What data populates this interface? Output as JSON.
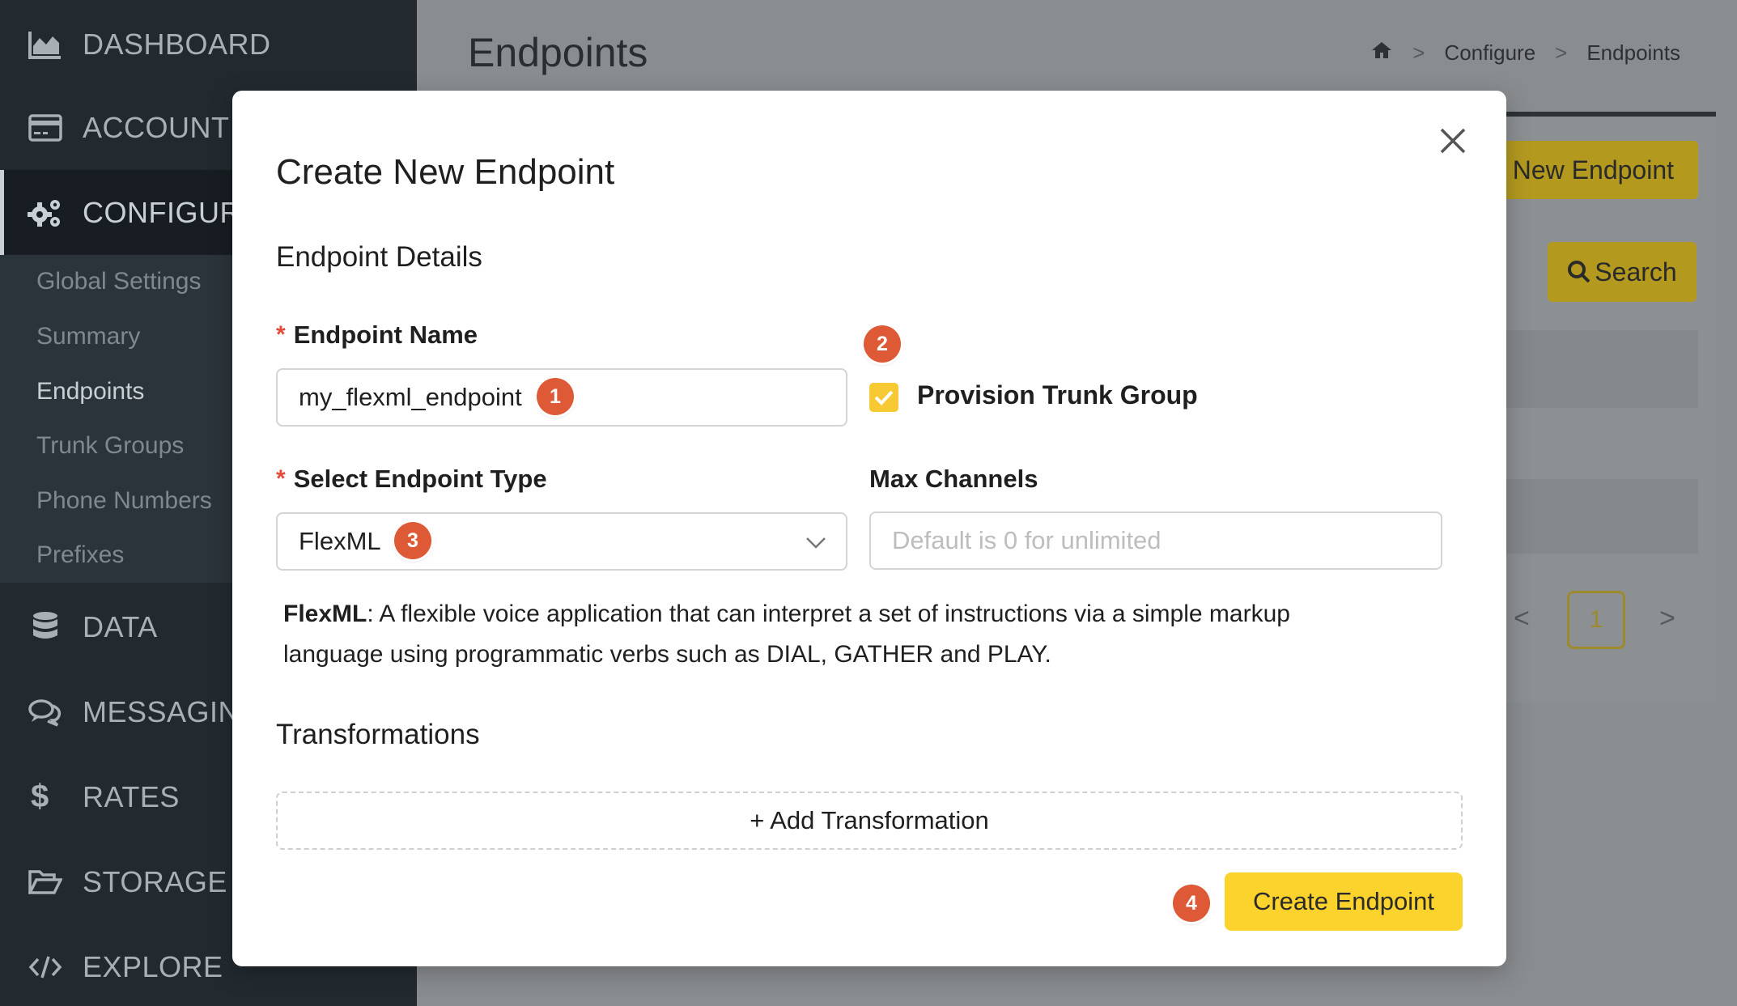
{
  "sidebar": {
    "items": [
      {
        "label": "DASHBOARD",
        "icon": "area-chart-icon"
      },
      {
        "label": "ACCOUNT",
        "icon": "credit-card-icon"
      },
      {
        "label": "CONFIGURE",
        "icon": "gears-icon"
      },
      {
        "label": "DATA",
        "icon": "database-icon"
      },
      {
        "label": "MESSAGING",
        "icon": "comments-icon"
      },
      {
        "label": "RATES",
        "icon": "dollar-icon"
      },
      {
        "label": "STORAGE",
        "icon": "folder-open-icon"
      },
      {
        "label": "EXPLORE",
        "icon": "code-icon"
      }
    ],
    "submenu": [
      "Global Settings",
      "Summary",
      "Endpoints",
      "Trunk Groups",
      "Phone Numbers",
      "Prefixes"
    ],
    "active_submenu": "Endpoints"
  },
  "header": {
    "title": "Endpoints",
    "breadcrumb": [
      "Configure",
      "Endpoints"
    ],
    "breadcrumb_separator": ">"
  },
  "background": {
    "new_endpoint_label": "New Endpoint",
    "search_label": "Search",
    "current_page": "1"
  },
  "modal": {
    "title": "Create New Endpoint",
    "section_details": "Endpoint Details",
    "endpoint_name_label": "Endpoint Name",
    "endpoint_name_value": "my_flexml_endpoint",
    "provision_trunk_group_label": "Provision Trunk Group",
    "provision_trunk_group_checked": true,
    "endpoint_type_label": "Select Endpoint Type",
    "endpoint_type_value": "FlexML",
    "max_channels_label": "Max Channels",
    "max_channels_placeholder": "Default is 0 for unlimited",
    "description_term": "FlexML",
    "description_text": ": A flexible voice application that can interpret a set of instructions via a simple markup language using programmatic verbs such as DIAL, GATHER and PLAY.",
    "section_transformations": "Transformations",
    "add_transformation_label": "+ Add Transformation",
    "create_button_label": "Create Endpoint",
    "required_marker": "*"
  },
  "badges": [
    "1",
    "2",
    "3",
    "4"
  ],
  "colors": {
    "accent": "#fcd22d",
    "badge": "#de5a36",
    "sidebar_bg": "#222a30",
    "required": "#e24b3b"
  }
}
